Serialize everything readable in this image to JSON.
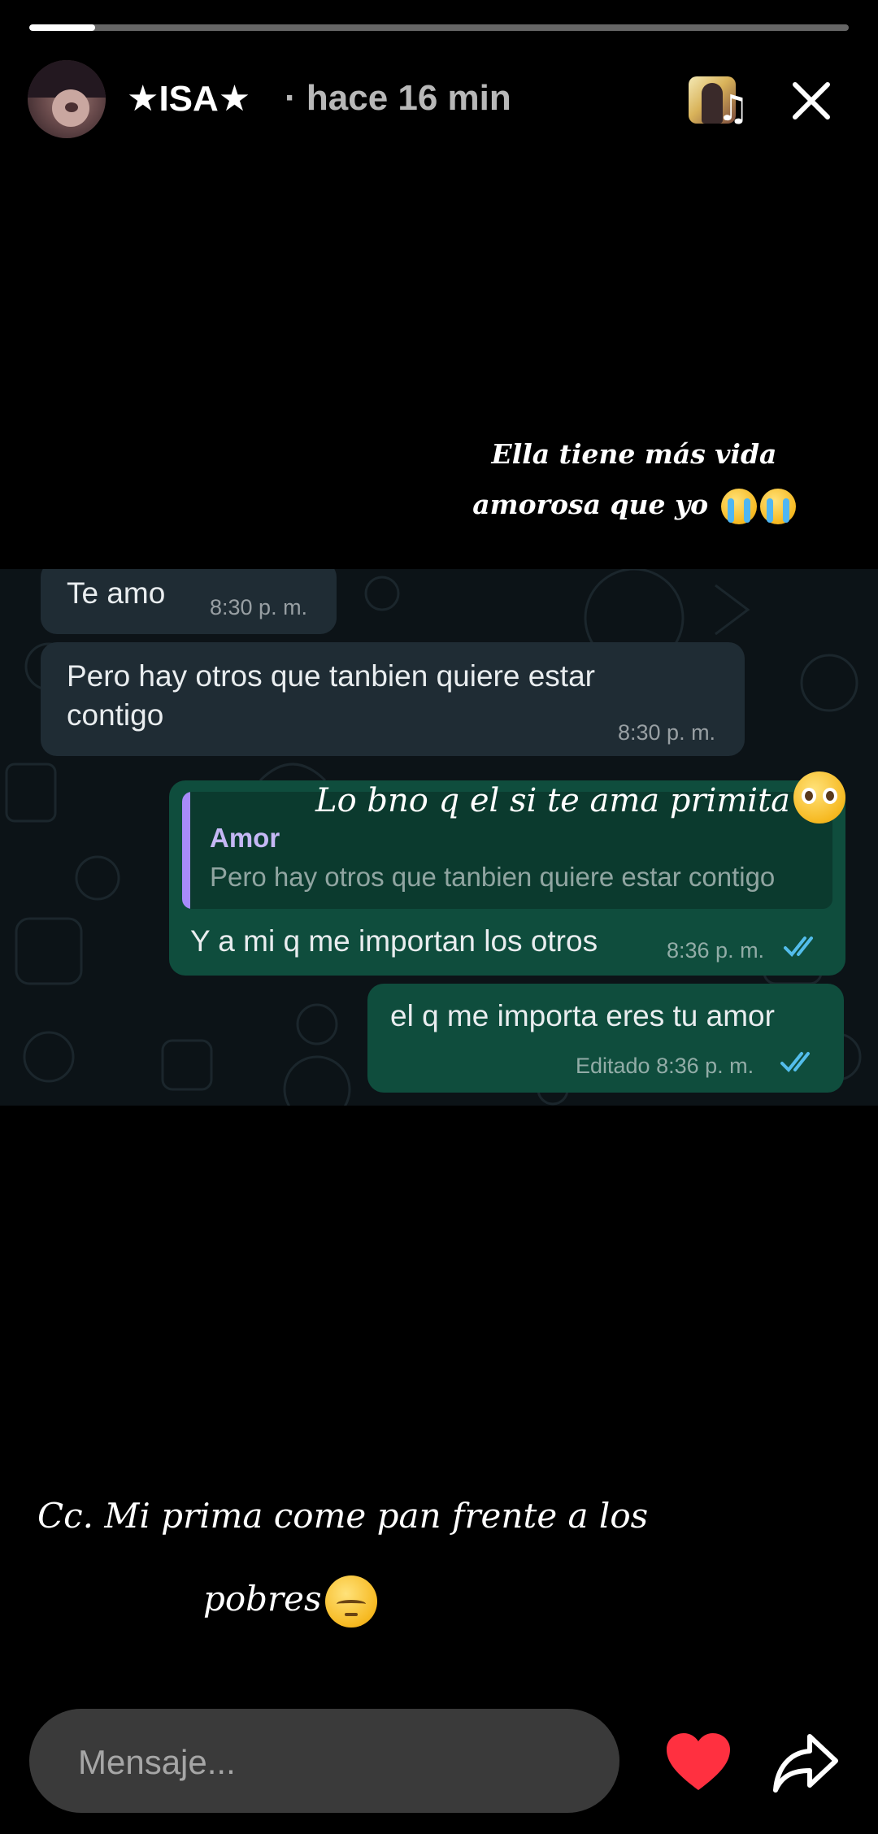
{
  "story": {
    "progress": 0.08,
    "username": "★ISA★",
    "time": "· hace 16 min",
    "music_icon": "music-note-icon",
    "close_icon": "close-icon"
  },
  "captions": {
    "top_line1": "Ella tiene más vida",
    "top_line2": "amorosa que yo",
    "overlay_script": "Lo bno q el si te ama primita",
    "bottom_line1": "Cc. Mi prima come pan frente a los",
    "bottom_line2": "pobres"
  },
  "chat": {
    "messages": [
      {
        "text": "Te amo",
        "time": "8:30 p. m."
      },
      {
        "text_line1": "Pero  hay otros que tanbien quiere estar",
        "text_line2": "contigo",
        "time": "8:30 p. m."
      },
      {
        "quote_author": "Amor",
        "quote_text": "Pero  hay otros que tanbien quiere estar contigo",
        "text": "Y a mi q me importan los otros",
        "time": "8:36 p. m."
      },
      {
        "text": "el q me importa eres tu amor",
        "time": "Editado 8:36 p. m."
      }
    ]
  },
  "footer": {
    "placeholder": "Mensaje...",
    "like_icon": "heart-icon",
    "share_icon": "share-arrow-icon"
  },
  "colors": {
    "background": "#000000",
    "chat_bg": "#0c1317",
    "incoming_bubble": "#1f2c34",
    "outgoing_bubble": "#0f4d3d",
    "quote_bar": "#a78bfa",
    "ticks": "#53bdeb",
    "heart": "#ff3040"
  }
}
